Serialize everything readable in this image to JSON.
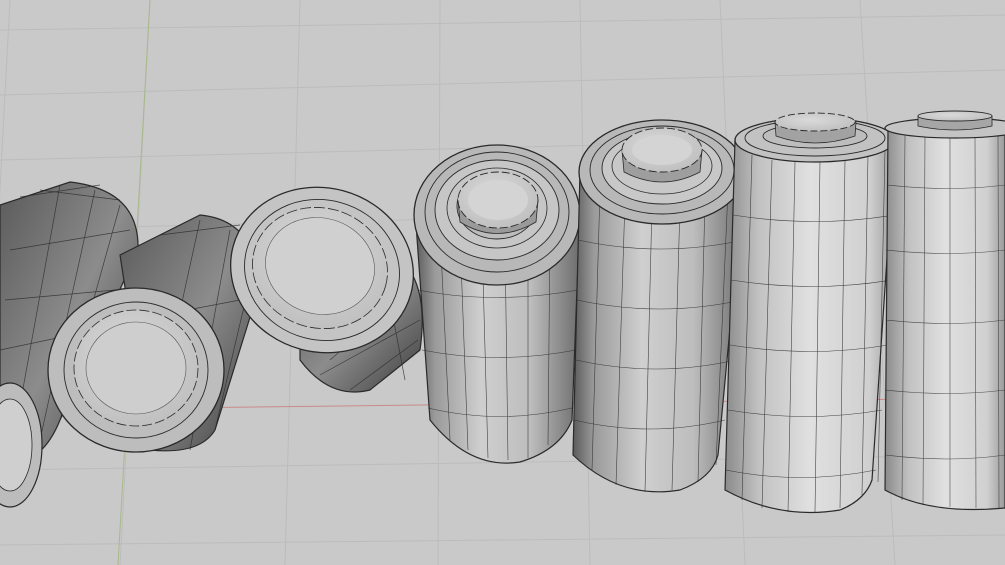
{
  "viewport": {
    "background": "#c9c9c9",
    "grid_color": "#b8b8b8",
    "axis_x_color": "#c98a8a",
    "axis_y_color": "#a9b98a",
    "wire_color": "#2a2a2a",
    "body_light": "#d6d6d6",
    "body_dark": "#4a4a4a"
  },
  "objects": [
    {
      "id": "cell-1",
      "kind": "cylinder",
      "view": "tilted-end"
    },
    {
      "id": "cell-2",
      "kind": "cylinder",
      "view": "tilted-end"
    },
    {
      "id": "cell-3",
      "kind": "cylinder",
      "view": "tilted-end"
    },
    {
      "id": "cell-4",
      "kind": "cylinder",
      "view": "upright-cap"
    },
    {
      "id": "cell-5",
      "kind": "cylinder",
      "view": "upright-cap"
    },
    {
      "id": "cell-6",
      "kind": "cylinder",
      "view": "upright-cap"
    },
    {
      "id": "cell-7",
      "kind": "cylinder",
      "view": "upright-cap"
    }
  ]
}
